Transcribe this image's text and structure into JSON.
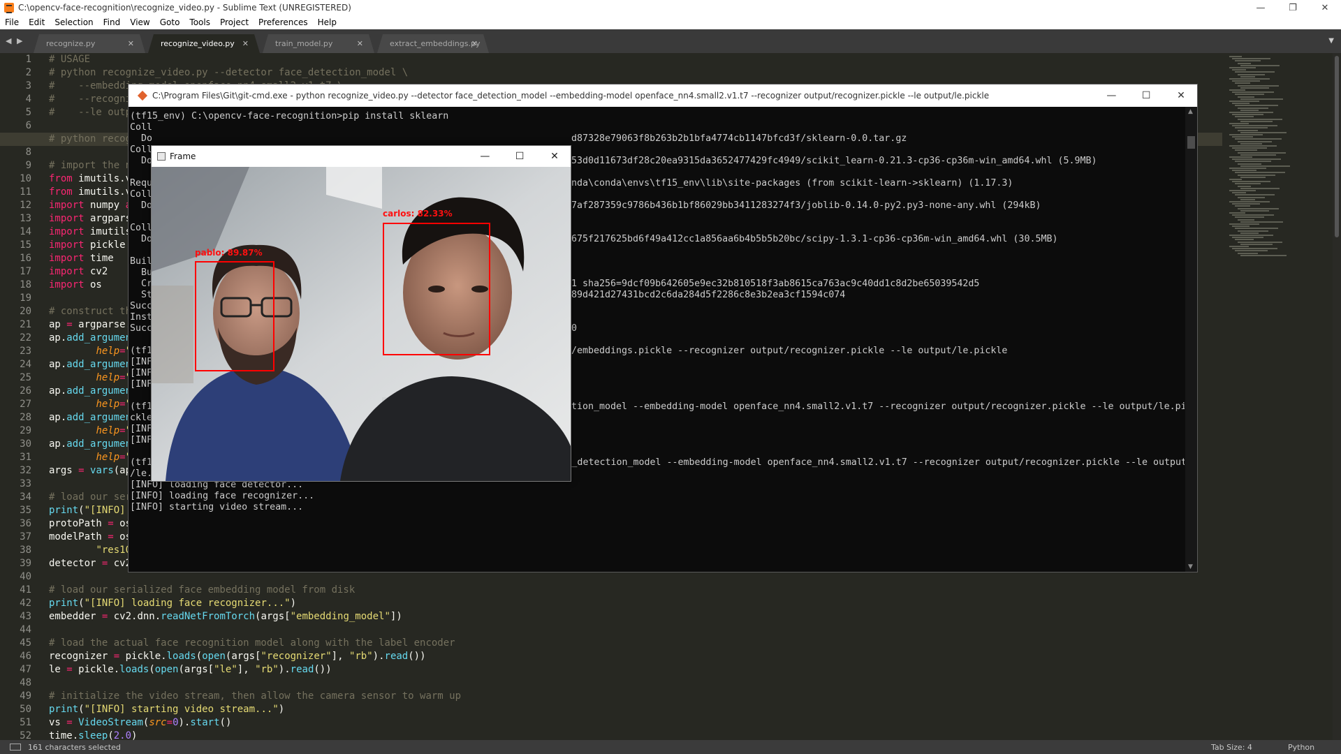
{
  "app": {
    "title": "C:\\opencv-face-recognition\\recognize_video.py - Sublime Text (UNREGISTERED)",
    "controls": {
      "minimize": "—",
      "maximize": "❐",
      "close": "✕"
    }
  },
  "menu": [
    "File",
    "Edit",
    "Selection",
    "Find",
    "View",
    "Goto",
    "Tools",
    "Project",
    "Preferences",
    "Help"
  ],
  "tabs": [
    {
      "label": "recognize.py",
      "active": false
    },
    {
      "label": "recognize_video.py",
      "active": true
    },
    {
      "label": "train_model.py",
      "active": false
    },
    {
      "label": "extract_embeddings.py",
      "active": false
    }
  ],
  "editor": {
    "current_line": 7,
    "line_numbers": [
      "1",
      "2",
      "3",
      "4",
      "5",
      "6",
      "7",
      "8",
      "9",
      "10",
      "11",
      "12",
      "13",
      "14",
      "15",
      "16",
      "17",
      "18",
      "19",
      "20",
      "21",
      "22",
      "23",
      "24",
      "25",
      "26",
      "27",
      "28",
      "29",
      "30",
      "31",
      "32",
      "33",
      "34",
      "35",
      "36",
      "37",
      "38",
      "39",
      "40",
      "41",
      "42",
      "43",
      "44",
      "45",
      "46",
      "47",
      "48",
      "49",
      "50",
      "51",
      "52"
    ]
  },
  "status": {
    "selection": "161 characters selected",
    "tab_size": "Tab Size: 4",
    "syntax": "Python"
  },
  "console": {
    "title": "C:\\Program Files\\Git\\git-cmd.exe - python  recognize_video.py --detector face_detection_model --embedding-model openface_nn4.small2.v1.t7 --recognizer output/recognizer.pickle --le output/le.pickle",
    "left_lines": [
      {
        "t": "(tf15_env) C:\\opencv-face-recognition>pip install sklearn",
        "y": 0
      },
      {
        "t": "Coll",
        "y": 1
      },
      {
        "t": "  Do",
        "y": 2
      },
      {
        "t": "Coll",
        "y": 3
      },
      {
        "t": "  Do",
        "y": 4
      },
      {
        "t": "Requ",
        "y": 6
      },
      {
        "t": "Coll",
        "y": 7
      },
      {
        "t": "  Do",
        "y": 8
      },
      {
        "t": "Coll",
        "y": 10
      },
      {
        "t": "  Do",
        "y": 11
      },
      {
        "t": "Buil",
        "y": 13
      },
      {
        "t": "  Bu",
        "y": 14
      },
      {
        "t": "  Cr",
        "y": 15
      },
      {
        "t": "  St",
        "y": 16
      },
      {
        "t": "Succ",
        "y": 17
      },
      {
        "t": "Inst",
        "y": 18
      },
      {
        "t": "Succ",
        "y": 19
      },
      {
        "t": "(tf1",
        "y": 21
      },
      {
        "t": "[INF",
        "y": 22
      },
      {
        "t": "[INF",
        "y": 23
      },
      {
        "t": "[INF",
        "y": 24
      },
      {
        "t": "(tf1",
        "y": 26
      },
      {
        "t": "ckle",
        "y": 27
      },
      {
        "t": "[INF",
        "y": 28
      },
      {
        "t": "[INF",
        "y": 29
      }
    ],
    "right_lines": [
      {
        "t": "d87328e79063f8b263b2b1bfa4774cb1147bfcd3f/sklearn-0.0.tar.gz",
        "y": 2
      },
      {
        "t": "53d0d11673df28c20ea9315da3652477429fc4949/scikit_learn-0.21.3-cp36-cp36m-win_amd64.whl (5.9MB)",
        "y": 4
      },
      {
        "t": "nda\\conda\\envs\\tf15_env\\lib\\site-packages (from scikit-learn->sklearn) (1.17.3)",
        "y": 6
      },
      {
        "t": "7af287359c9786b436b1bf86029bb3411283274f3/joblib-0.14.0-py2.py3-none-any.whl (294kB)",
        "y": 8
      },
      {
        "t": "675f217625bd6f49a412cc1a856aa6b4b5b5b20bc/scipy-1.3.1-cp36-cp36m-win_amd64.whl (30.5MB)",
        "y": 11
      },
      {
        "t": "1 sha256=9dcf09b642605e9ec32b810518f3ab8615ca763ac9c40dd1c8d2be65039542d5",
        "y": 15
      },
      {
        "t": "89d421d27431bcd2c6da284d5f2286c8e3b2ea3cf1594c074",
        "y": 16
      },
      {
        "t": "0",
        "y": 19
      },
      {
        "t": "/embeddings.pickle --recognizer output/recognizer.pickle --le output/le.pickle",
        "y": 21
      },
      {
        "t": "tion_model --embedding-model openface_nn4.small2.v1.t7 --recognizer output/recognizer.pickle --le output/le.pi",
        "y": 26
      }
    ],
    "bottom_lines": [
      {
        "t": "(tf15_env) C:\\opencv-face-recognition>python recognize_video.py --detector face_detection_model --embedding-model openface_nn4.small2.v1.t7 --recognizer output/recognizer.pickle --le output",
        "y": 31
      },
      {
        "t": "/le.pickle",
        "y": 32
      },
      {
        "t": "[INFO] loading face detector...",
        "y": 33
      },
      {
        "t": "[INFO] loading face recognizer...",
        "y": 34
      },
      {
        "t": "[INFO] starting video stream...",
        "y": 35
      }
    ]
  },
  "frame": {
    "title": "Frame",
    "faces": [
      {
        "label": "pablo: 89.87%"
      },
      {
        "label": "carlos: 82.33%"
      }
    ]
  },
  "colors": {
    "editor_bg": "#272822",
    "comment": "#75715e",
    "keyword": "#f92672",
    "string": "#e6db74",
    "function": "#66d9ef",
    "detection_box": "#ff0000"
  }
}
